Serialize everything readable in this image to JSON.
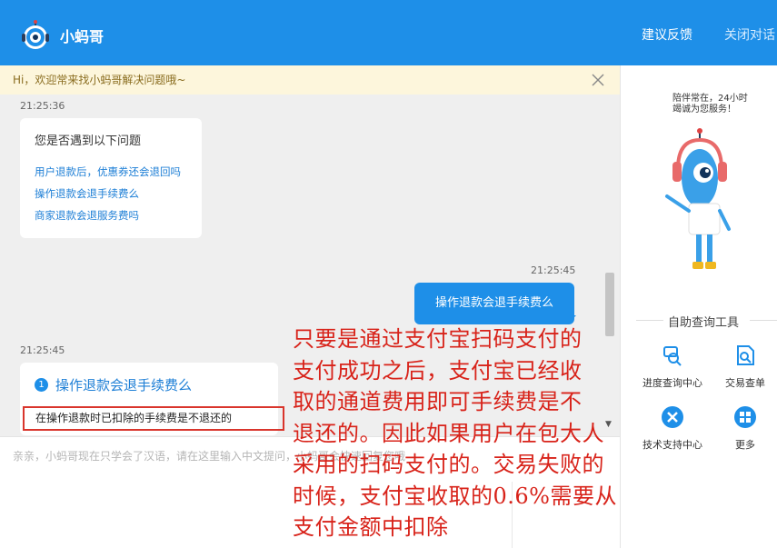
{
  "header": {
    "title": "小蚂哥",
    "feedback_label": "建议反馈",
    "close_chat_label": "关闭对话"
  },
  "notice": {
    "text": "Hi，欢迎常来找小蚂哥解决问题哦~"
  },
  "messages": {
    "t1": "21:25:36",
    "bot1": {
      "question": "您是否遇到以下问题",
      "links": [
        "用户退款后，优惠券还会退回吗",
        "操作退款会退手续费么",
        "商家退款会退服务费吗"
      ]
    },
    "t2": "21:25:45",
    "user": "操作退款会退手续费么",
    "t3": "21:25:45",
    "bot2": {
      "badge": "1",
      "title": "操作退款会退手续费么",
      "answer": "在操作退款时已扣除的手续费是不退还的"
    }
  },
  "input": {
    "placeholder": "亲亲，小蚂哥现在只学会了汉语，请在这里输入中文提问，小蚂哥会快速回复您哦"
  },
  "sidebar": {
    "tagline_1": "陪伴常在，24小时",
    "tagline_2": "竭诚为您服务！",
    "tools_title": "自助查询工具",
    "tools": [
      {
        "label": "进度查询中心",
        "icon": "progress-search-icon"
      },
      {
        "label": "交易查单",
        "icon": "transaction-query-icon"
      },
      {
        "label": "技术支持中心",
        "icon": "tech-support-icon"
      },
      {
        "label": "更多",
        "icon": "more-grid-icon"
      }
    ]
  },
  "annotation": {
    "lines": [
      "只要是通过支付宝扫码支付的",
      "支付成功之后，支付宝已经收",
      "取的通道费用即可手续费是不",
      "退还的。因此如果用户在包大人",
      "采用的扫码支付的。交易失败的",
      "时候，支付宝收取的0.6%需要从",
      "支付金额中扣除"
    ]
  },
  "colors": {
    "brand": "#1e8fe8",
    "annotation": "#d8231a",
    "highlight_border": "#d9352c"
  }
}
